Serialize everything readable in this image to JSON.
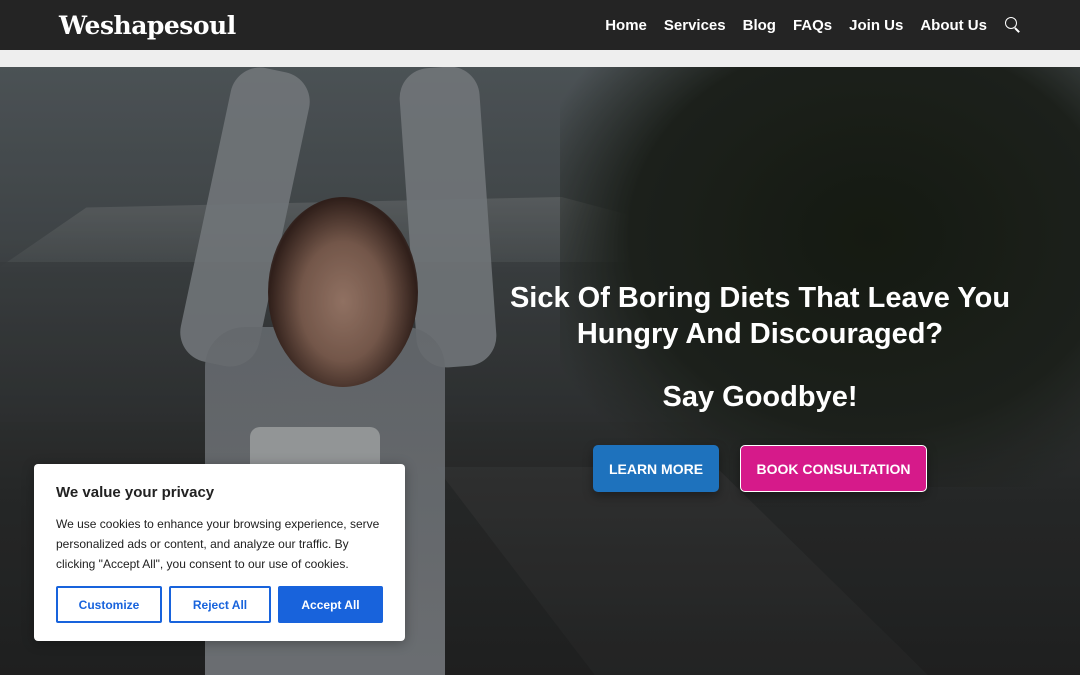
{
  "header": {
    "logo": "Weshapesoul",
    "nav": [
      "Home",
      "Services",
      "Blog",
      "FAQs",
      "Join Us",
      "About Us"
    ],
    "search_icon": "search-icon"
  },
  "hero": {
    "headline_line1": "Sick Of Boring Diets That Leave You",
    "headline_line2": "Hungry And Discouraged?",
    "subhead": "Say Goodbye!",
    "learn_more": "LEARN MORE",
    "book_consultation": "BOOK CONSULTATION"
  },
  "cookie": {
    "title": "We value your privacy",
    "text": "We use cookies to enhance your browsing experience, serve personalized ads or content, and analyze our traffic. By clicking \"Accept All\", you consent to our use of cookies.",
    "customize": "Customize",
    "reject": "Reject All",
    "accept": "Accept All"
  },
  "colors": {
    "header_bg": "#242424",
    "learn_more_bg": "#1e72bd",
    "book_bg": "#d61a8a",
    "cookie_accent": "#1863dc"
  }
}
